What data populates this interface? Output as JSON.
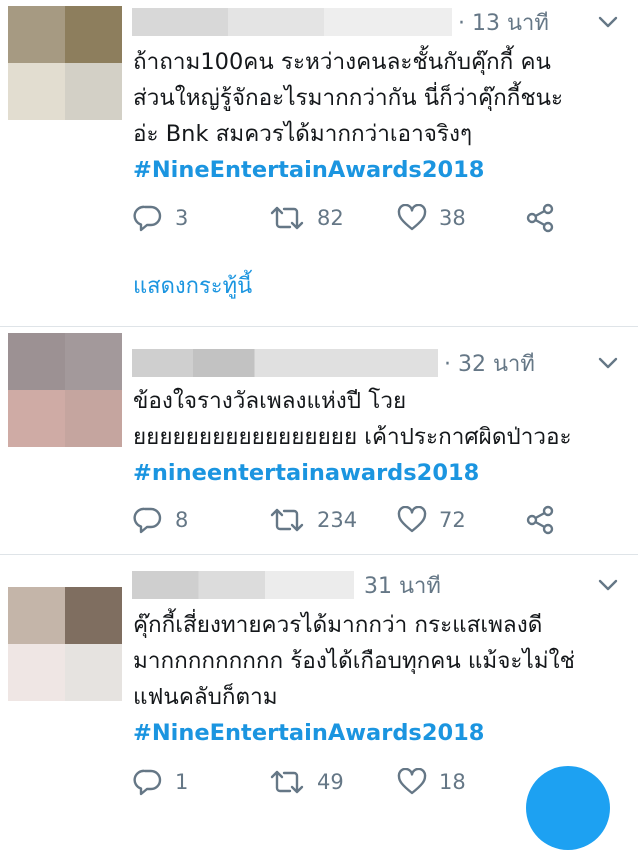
{
  "tweets": [
    {
      "time": "· 13 นาที",
      "lines": [
        "ถ้าถาม100คน ระหว่างคนละชั้นกับคุ๊กกี้ คน",
        "ส่วนใหญ่รู้จักอะไรมากกว่ากัน  นี่ก็ว่าคุ๊กกี้ชนะ",
        "อ่ะ Bnk สมควรได้มากกว่าเอาจริงๆ"
      ],
      "hashtag": "#NineEntertainAwards2018",
      "replies": "3",
      "retweets": "82",
      "likes": "38",
      "show_thread": "แสดงกระทู้นี้",
      "avatar_colors": [
        "#a69a82",
        "#8d7e5d",
        "#e2ddd0",
        "#d3d0c6"
      ]
    },
    {
      "time": "· 32 นาที",
      "lines": [
        "ข้องใจรางวัลเพลงแห่งปี โวย",
        "ยยยยยยยยยยยยยยยยย เค้าประกาศผิดป่าวอะ"
      ],
      "hashtag": "#nineentertainawards2018",
      "replies": "8",
      "retweets": "234",
      "likes": "72",
      "avatar_colors": [
        "#9c9193",
        "#a3999b",
        "#cfaba5",
        "#c5a59f"
      ]
    },
    {
      "time": "31 นาที",
      "lines": [
        "คุ๊กกี้เสี่ยงทายควรได้มากกว่า กระแสเพลงดี",
        "มากกกกกกกกก ร้องได้เกือบทุกคน แม้จะไม่ใช่",
        "แฟนคลับก็ตาม"
      ],
      "hashtag": "#NineEntertainAwards2018",
      "replies": "1",
      "retweets": "49",
      "likes": "18",
      "avatar_colors": [
        "#c4b5a9",
        "#7f6e60",
        "#efe6e4",
        "#e6e3e0"
      ]
    }
  ],
  "colors": {
    "link": "#1b95e0",
    "muted": "#657786",
    "divider": "#dfe4e8",
    "fab": "#1da1f2"
  }
}
